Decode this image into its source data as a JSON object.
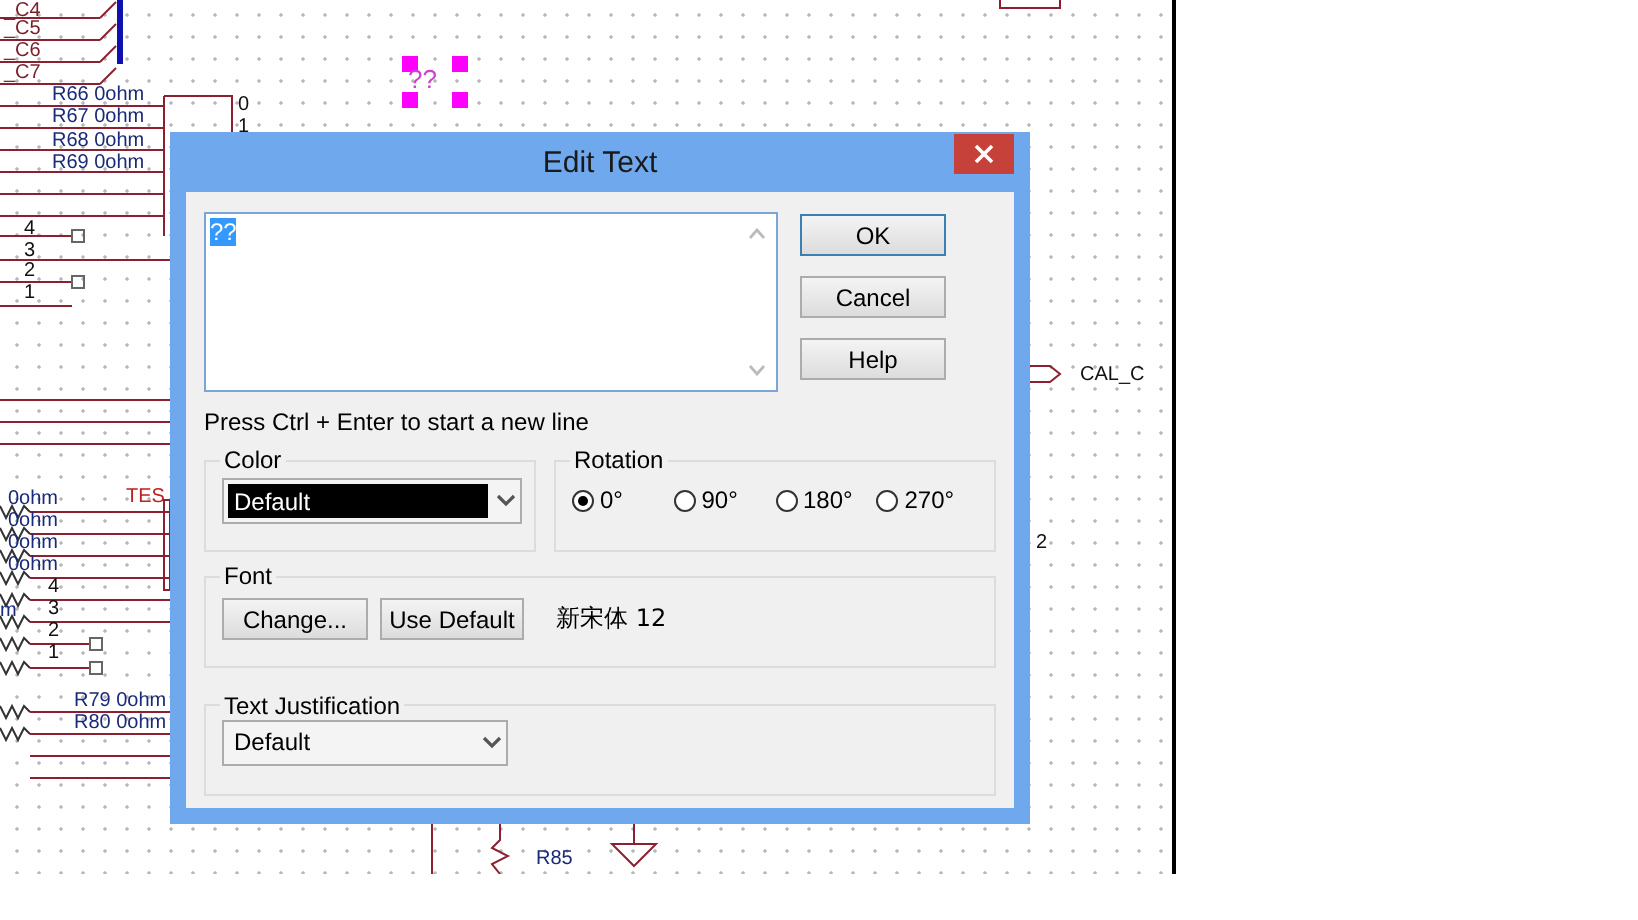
{
  "schematic": {
    "selected_text": "??",
    "labels": [
      {
        "text": "_C4",
        "kind": "net"
      },
      {
        "text": "_C5",
        "kind": "net"
      },
      {
        "text": "_C6",
        "kind": "net"
      },
      {
        "text": "_C7",
        "kind": "net"
      },
      {
        "text": "R66 0ohm",
        "kind": "part"
      },
      {
        "text": "R67 0ohm",
        "kind": "part"
      },
      {
        "text": "R68 0ohm",
        "kind": "part"
      },
      {
        "text": "R69 0ohm",
        "kind": "part"
      },
      {
        "text": "0",
        "kind": "pin"
      },
      {
        "text": "1",
        "kind": "pin"
      },
      {
        "text": "4",
        "kind": "pin"
      },
      {
        "text": "3",
        "kind": "pin"
      },
      {
        "text": "2",
        "kind": "pin"
      },
      {
        "text": "1",
        "kind": "pin"
      },
      {
        "text": "0ohm",
        "kind": "part"
      },
      {
        "text": "0ohm",
        "kind": "part"
      },
      {
        "text": "0ohm",
        "kind": "part"
      },
      {
        "text": "0ohm",
        "kind": "part"
      },
      {
        "text": "TES",
        "kind": "net"
      },
      {
        "text": "4",
        "kind": "pin"
      },
      {
        "text": "3",
        "kind": "pin"
      },
      {
        "text": "m",
        "kind": "part"
      },
      {
        "text": "2",
        "kind": "pin"
      },
      {
        "text": "1",
        "kind": "pin"
      },
      {
        "text": "R79 0ohm",
        "kind": "part"
      },
      {
        "text": "R80 0ohm",
        "kind": "part"
      },
      {
        "text": "R85",
        "kind": "part"
      },
      {
        "text": "CAL_C",
        "kind": "port"
      },
      {
        "text": "2",
        "kind": "pin"
      }
    ]
  },
  "window": {
    "title": "Edit Text"
  },
  "text_field": {
    "value": "??",
    "highlighted": true
  },
  "buttons": [
    {
      "label": "OK",
      "default": true
    },
    {
      "label": "Cancel",
      "default": false
    },
    {
      "label": "Help",
      "default": false
    }
  ],
  "hint": "Press Ctrl + Enter to start a new line",
  "color": {
    "label": "Color",
    "value": "Default"
  },
  "rotation": {
    "label": "Rotation",
    "options": [
      {
        "label": "0°",
        "selected": true
      },
      {
        "label": "90°",
        "selected": false
      },
      {
        "label": "180°",
        "selected": false
      },
      {
        "label": "270°",
        "selected": false
      }
    ]
  },
  "font": {
    "label": "Font",
    "buttons": [
      "Change...",
      "Use Default"
    ],
    "current": "新宋体 12"
  },
  "justification": {
    "label": "Text Justification",
    "value": "Default"
  }
}
